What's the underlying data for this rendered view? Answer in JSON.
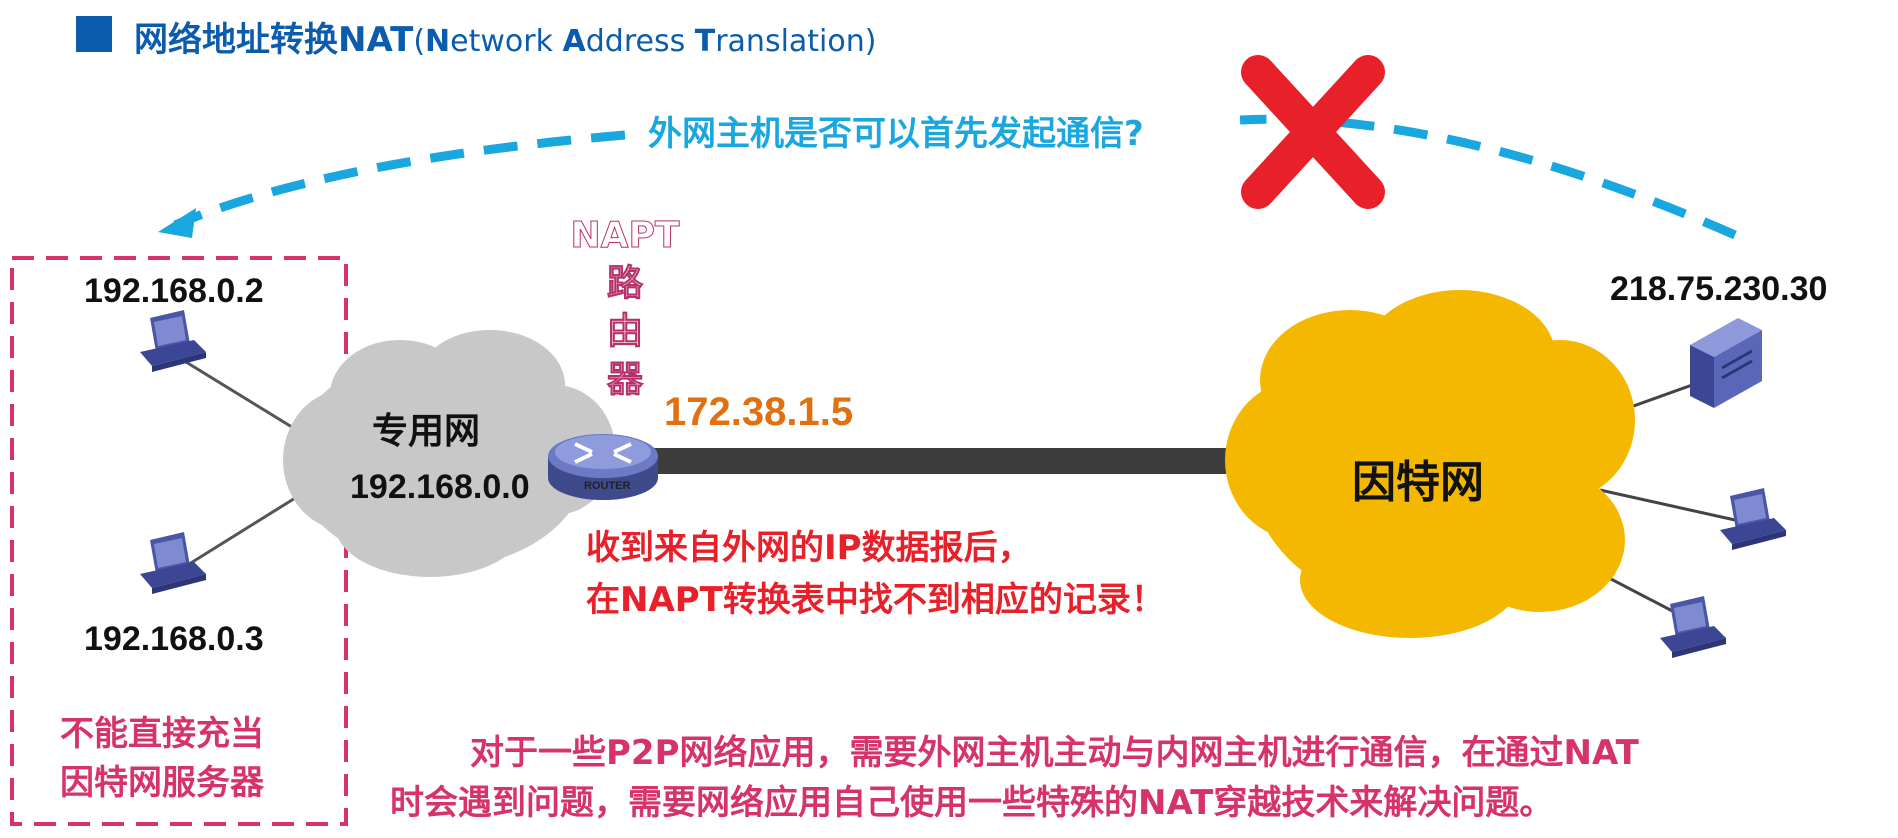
{
  "title": {
    "cn": "网络地址转换NAT",
    "en_open": "(",
    "en_N": "N",
    "en_etwork": "etwork ",
    "en_A": "A",
    "en_ddress": "ddress ",
    "en_T": "T",
    "en_ranslation": "ranslation)"
  },
  "question": "外网主机是否可以首先发起通信?",
  "private_network": {
    "label": "专用网",
    "address": "192.168.0.0",
    "hosts": [
      "192.168.0.2",
      "192.168.0.3"
    ],
    "note_line1": "不能直接充当",
    "note_line2": "因特网服务器"
  },
  "router": {
    "label_chars": [
      "NAPT",
      "路",
      "由",
      "器"
    ],
    "ip": "172.38.1.5",
    "caption": "ROUTER"
  },
  "internet": {
    "label": "因特网",
    "server_ip": "218.75.230.30"
  },
  "router_message": {
    "line1": "收到来自外网的IP数据报后，",
    "line2": "在NAPT转换表中找不到相应的记录！"
  },
  "explanation": {
    "line1": "对于一些P2P网络应用，需要外网主机主动与内网主机进行通信，在通过NAT",
    "line2": "时会遇到问题，需要网络应用自己使用一些特殊的NAT穿越技术来解决问题。"
  },
  "colors": {
    "title": "#0b5cad",
    "arc": "#1aa7e0",
    "cross": "#e8202a",
    "private_box": "#d6336c",
    "internet_cloud": "#f5b800",
    "private_cloud": "#c8c8c8"
  },
  "icons": [
    "x-mark-icon",
    "router-icon",
    "pc-icon",
    "server-icon",
    "arrow-head-icon"
  ]
}
